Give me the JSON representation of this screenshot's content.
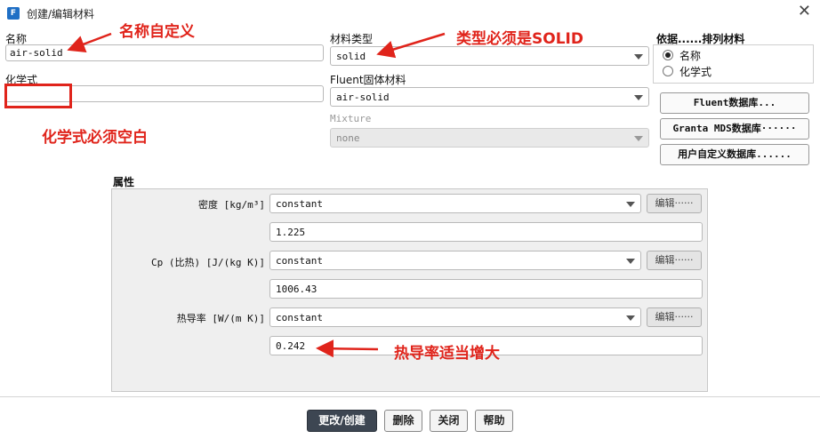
{
  "window": {
    "title": "创建/编辑材料",
    "app_icon_letter": "F"
  },
  "left": {
    "name_label": "名称",
    "name_value": "air-solid",
    "formula_label": "化学式",
    "formula_value": ""
  },
  "middle": {
    "material_type_label": "材料类型",
    "material_type_value": "solid",
    "fluent_material_label": "Fluent固体材料",
    "fluent_material_value": "air-solid",
    "mixture_label": "Mixture",
    "mixture_value": "none"
  },
  "sort": {
    "title": "依据......排列材料",
    "options": [
      "名称",
      "化学式"
    ],
    "selected": "名称"
  },
  "side_buttons": [
    "Fluent数据库...",
    "Granta MDS数据库······",
    "用户自定义数据库......"
  ],
  "properties": {
    "section_label": "属性",
    "rows": [
      {
        "label": "密度 [kg/m³]",
        "method": "constant",
        "edit_label": "编辑······",
        "value": "1.225"
      },
      {
        "label": "Cp (比热) [J/(kg K)]",
        "method": "constant",
        "edit_label": "编辑······",
        "value": "1006.43"
      },
      {
        "label": "热导率 [W/(m K)]",
        "method": "constant",
        "edit_label": "编辑······",
        "value": "0.242"
      }
    ]
  },
  "bottom_buttons": {
    "change_create": "更改/创建",
    "delete": "删除",
    "close": "关闭",
    "help": "帮助"
  },
  "annotations": {
    "name_custom": "名称自定义",
    "type_solid": "类型必须是SOLID",
    "formula_blank": "化学式必须空白",
    "conductivity": "热导率适当增大",
    "color": "#e0241b"
  },
  "icons": {
    "close": "close-icon",
    "dropdown": "chevron-down-icon"
  }
}
